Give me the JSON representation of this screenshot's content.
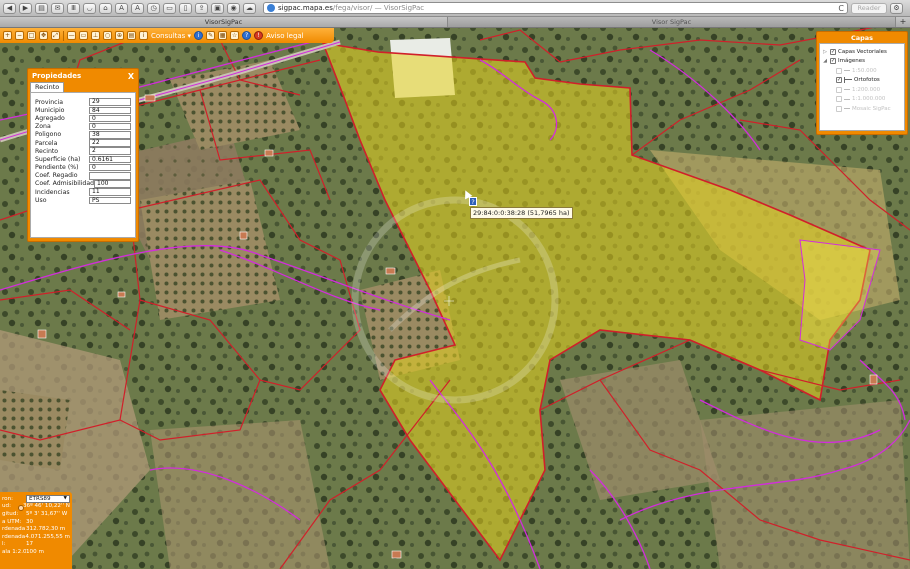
{
  "browser": {
    "url_host": "sigpac.mapa.es",
    "url_path": "/fega/visor/",
    "url_title_sep": "— VisorSigPac",
    "reader_label": "Reader",
    "tabs": [
      "VisorSigPac",
      "Visor SigPac"
    ],
    "new_tab": "+",
    "nav_icons": [
      "back-icon",
      "forward-icon",
      "print-icon",
      "mail-icon",
      "reader-list-icon",
      "bookmarks-icon",
      "home-icon",
      "text-smaller-icon",
      "text-larger-icon",
      "history-icon",
      "refresh-icon",
      "tabs-icon",
      "share-icon",
      "sidebar-icon",
      "stop-icon",
      "cloud-icon"
    ],
    "font_small": "A",
    "font_large": "A",
    "reload_glyph": "C"
  },
  "map_toolbar": {
    "consultas_label": "Consultas",
    "aviso_label": "Aviso legal"
  },
  "properties": {
    "title": "Propiedades",
    "close": "X",
    "tab": "Recinto",
    "rows": [
      {
        "label": "Provincia",
        "value": "29"
      },
      {
        "label": "Municipio",
        "value": "84"
      },
      {
        "label": "Agregado",
        "value": "0"
      },
      {
        "label": "Zona",
        "value": "0"
      },
      {
        "label": "Poligono",
        "value": "38"
      },
      {
        "label": "Parcela",
        "value": "22"
      },
      {
        "label": "Recinto",
        "value": "2"
      },
      {
        "label": "Superficie (ha)",
        "value": "0.6161"
      },
      {
        "label": "Pendiente (%)",
        "value": "0"
      },
      {
        "label": "Coef. Regadio",
        "value": ""
      },
      {
        "label": "Coef. Admisibilidad",
        "value": "100"
      },
      {
        "label": "Incidencias",
        "value": "11"
      },
      {
        "label": "Uso",
        "value": "PS"
      }
    ]
  },
  "layers": {
    "title": "Capas",
    "items": [
      {
        "label": "Capas Vectoriales",
        "checked": true,
        "disabled": false,
        "arrow": "▷"
      },
      {
        "label": "Imágenes",
        "checked": true,
        "disabled": false,
        "arrow": "◢"
      },
      {
        "label": "1:50.000",
        "checked": false,
        "disabled": true
      },
      {
        "label": "Ortofotos",
        "checked": true,
        "disabled": false
      },
      {
        "label": "1:200.000",
        "checked": false,
        "disabled": true
      },
      {
        "label": "1:1.000.000",
        "checked": false,
        "disabled": true
      },
      {
        "label": "Mosaic SigPac",
        "checked": false,
        "disabled": true
      }
    ]
  },
  "tooltip": {
    "help": "?",
    "text": "29:84:0:0:38:28 (51,7965 ha)"
  },
  "coordinates": {
    "projection_label": "ron:",
    "projection": "ETRS89",
    "rows": [
      {
        "label": "ud:",
        "value": "36º 46' 10,22'' N"
      },
      {
        "label": "gitud:",
        "value": "5º 3' 31,67'' W"
      },
      {
        "label": "a UTM:",
        "value": "30"
      },
      {
        "label": "rdenada X:",
        "value": "312.782,30 m"
      },
      {
        "label": "rdenada Y:",
        "value": "4.071.255,55 m"
      },
      {
        "label": "l:",
        "value": "17"
      },
      {
        "label": "ala 1:2.0",
        "value": "100 m"
      }
    ]
  },
  "colors": {
    "accent_orange": "#f08a00",
    "parcel_border": "#d0202a",
    "selection_fill": "#e6d21e",
    "road_magenta": "#d22ddc"
  }
}
